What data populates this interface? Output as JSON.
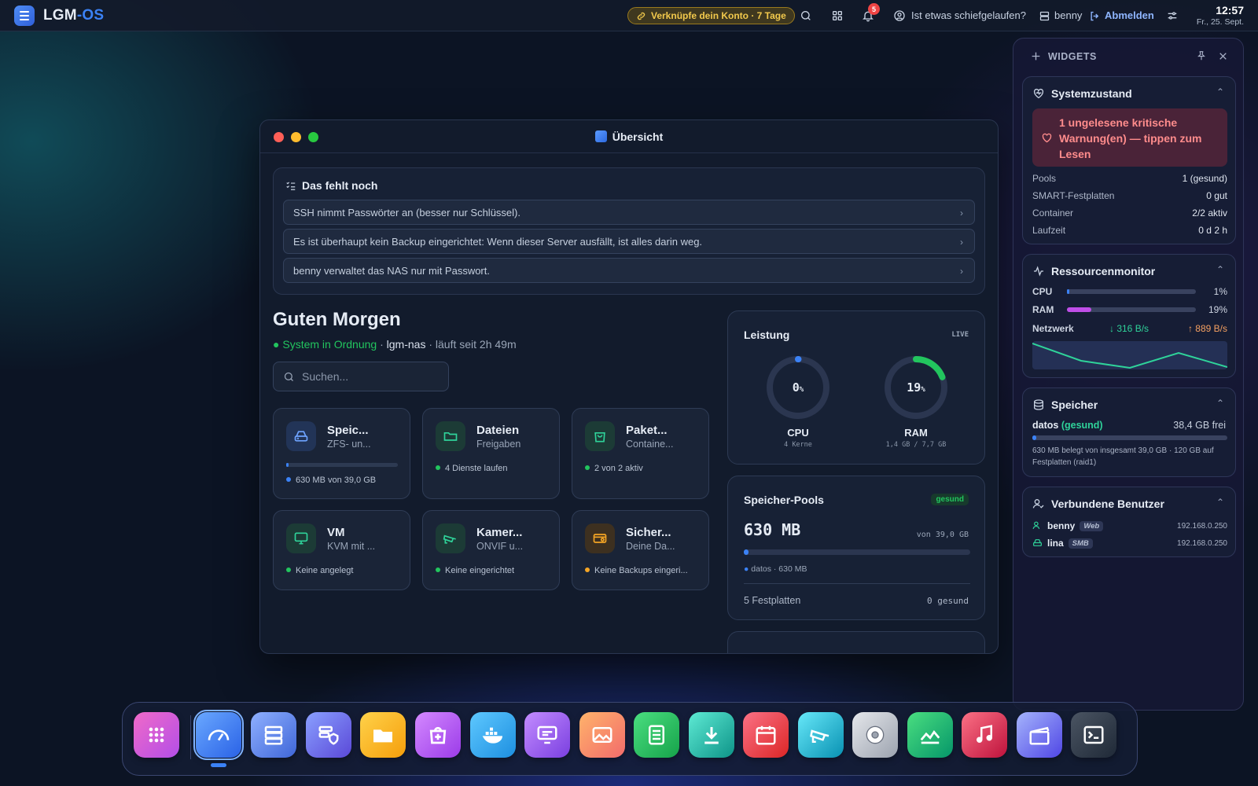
{
  "topbar": {
    "brand_main": "LGM",
    "brand_accent": "-OS",
    "account_pill": "Verknüpfe dein Konto · 7 Tage",
    "notification_count": "5",
    "help_text": "Ist etwas schiefgelaufen?",
    "user_name": "benny",
    "logout_label": "Abmelden",
    "time": "12:57",
    "date": "Fr., 25. Sept."
  },
  "window": {
    "title": "Übersicht",
    "todo": {
      "heading": "Das fehlt noch",
      "items": [
        "SSH nimmt Passwörter an (besser nur Schlüssel).",
        "Es ist überhaupt kein Backup eingerichtet: Wenn dieser Server ausfällt, ist alles darin weg.",
        "benny verwaltet das NAS nur mit Passwort."
      ]
    },
    "greeting": "Guten Morgen",
    "status_ok": "System in Ordnung",
    "hostname": "lgm-nas",
    "uptime": "läuft seit 2h 49m",
    "search_placeholder": "Suchen...",
    "tiles": [
      {
        "title": "Speic...",
        "subtitle": "ZFS- un...",
        "footer": "630 MB von 39,0 GB",
        "progress": 0.016
      },
      {
        "title": "Dateien",
        "subtitle": "Freigaben",
        "footer": "4 Dienste laufen"
      },
      {
        "title": "Paket...",
        "subtitle": "Containe...",
        "footer": "2 von 2 aktiv"
      },
      {
        "title": "VM",
        "subtitle": "KVM mit ...",
        "footer": "Keine angelegt"
      },
      {
        "title": "Kamer...",
        "subtitle": "ONVIF u...",
        "footer": "Keine eingerichtet"
      },
      {
        "title": "Sicher...",
        "subtitle": "Deine Da...",
        "footer": "Keine Backups eingeri..."
      }
    ],
    "performance": {
      "heading": "Leistung",
      "live": "LIVE",
      "cpu_value": "0",
      "cpu_unit": "%",
      "cpu_label": "CPU",
      "cpu_sub": "4 Kerne",
      "ram_value": "19",
      "ram_unit": "%",
      "ram_label": "RAM",
      "ram_sub": "1,4 GB / 7,7 GB",
      "cpu_fraction": 0.0,
      "ram_fraction": 0.19
    },
    "pools": {
      "heading": "Speicher-Pools",
      "badge": "gesund",
      "used": "630 MB",
      "total": "von 39,0 GB",
      "legend": "datos · 630 MB",
      "disks": "5 Festplatten",
      "disks_status": "0 gesund",
      "fraction": 0.016
    }
  },
  "widgets": {
    "header": "WIDGETS",
    "system": {
      "title": "Systemzustand",
      "warning": "1 ungelesene kritische Warnung(en) — tippen zum Lesen",
      "rows": [
        {
          "k": "Pools",
          "v": "1 (gesund)"
        },
        {
          "k": "SMART-Festplatten",
          "v": "0 gut"
        },
        {
          "k": "Container",
          "v": "2/2 aktiv"
        },
        {
          "k": "Laufzeit",
          "v": "0 d 2 h"
        }
      ]
    },
    "resources": {
      "title": "Ressourcenmonitor",
      "cpu_label": "CPU",
      "cpu_value": "1%",
      "cpu_fraction": 0.01,
      "ram_label": "RAM",
      "ram_value": "19%",
      "ram_fraction": 0.19,
      "net_label": "Netzwerk",
      "net_down": "↓ 316 B/s",
      "net_up": "↑ 889 B/s"
    },
    "storage": {
      "title": "Speicher",
      "pool_name": "datos",
      "pool_state": "(gesund)",
      "free": "38,4 GB frei",
      "fraction": 0.016,
      "detail": "630 MB belegt von insgesamt 39,0 GB · 120 GB auf Festplatten (raid1)"
    },
    "users": {
      "title": "Verbundene Benutzer",
      "list": [
        {
          "name": "benny",
          "proto": "Web",
          "ip": "192.168.0.250"
        },
        {
          "name": "lina",
          "proto": "SMB",
          "ip": "192.168.0.250"
        }
      ]
    }
  },
  "dock": {
    "apps": [
      "launcher-icon",
      "dashboard-icon",
      "server-icon",
      "security-icon",
      "files-icon",
      "store-icon",
      "docker-icon",
      "vm-icon",
      "photos-icon",
      "docs-icon",
      "download-icon",
      "calendar-icon",
      "camera-icon",
      "settings-icon",
      "monitor-icon",
      "music-icon",
      "video-icon",
      "terminal-icon"
    ]
  },
  "colors": {
    "accent": "#3b82f6",
    "ok": "#22c55e",
    "warn": "#ff8c8c",
    "pill": "#f2c94c"
  }
}
